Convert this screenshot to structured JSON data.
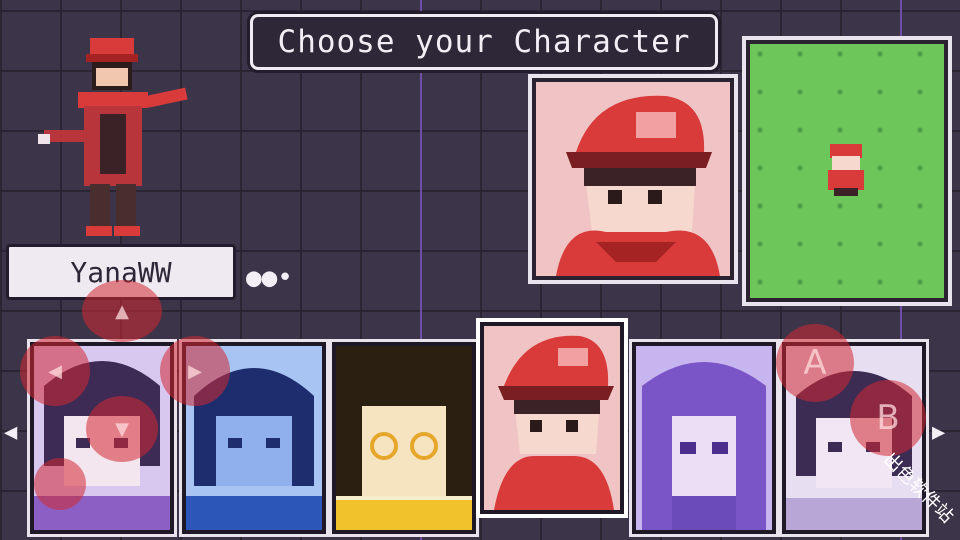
{
  "screen": {
    "title": "Choose your Character",
    "player_name": "YanaWW",
    "more_indicator": "●●•"
  },
  "colors": {
    "background": "#3c3448",
    "grid_accent": "#6e4fa8",
    "panel_light": "#f3eef6",
    "hero_red": "#d93a3a",
    "map_grass": "#6cc65a"
  },
  "characters": [
    {
      "id": "purple-girl",
      "tint": "#d8c8f0",
      "selected": false
    },
    {
      "id": "blue-girl",
      "tint": "#a7c4f2",
      "selected": false
    },
    {
      "id": "glasses-girl",
      "tint": "#f2d25c",
      "selected": false
    },
    {
      "id": "red-cap-boy",
      "tint": "#f0c4c4",
      "selected": true
    },
    {
      "id": "violet-girl",
      "tint": "#c7b5f0",
      "selected": false
    },
    {
      "id": "lilac-girl",
      "tint": "#e7def2",
      "selected": false
    }
  ],
  "carousel": {
    "left_arrow": "◀",
    "right_arrow": "▶"
  },
  "controls": {
    "dpad": {
      "up": "▲",
      "left": "◀",
      "right": "▶",
      "down": "▼"
    },
    "a_label": "A",
    "b_label": "B"
  },
  "watermark": "出色软件站"
}
